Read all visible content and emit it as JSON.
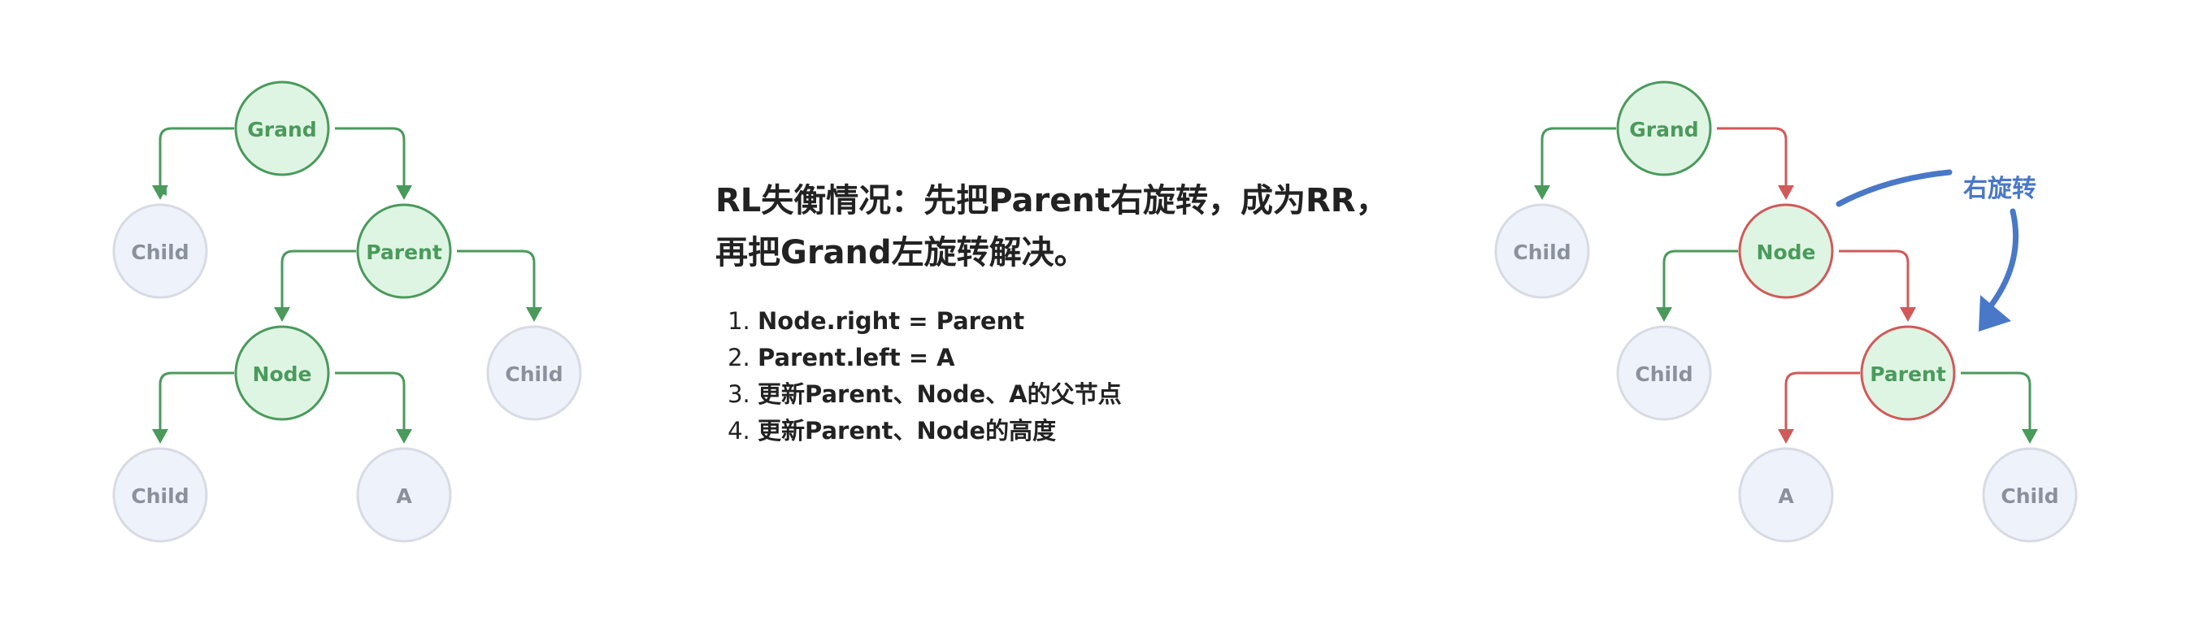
{
  "left_tree": {
    "grand": "Grand",
    "parent": "Parent",
    "node": "Node",
    "child_grand_left": "Child",
    "child_parent_right": "Child",
    "child_node_left": "Child",
    "a": "A"
  },
  "description": {
    "title_line1": "RL失衡情况：先把Parent右旋转，成为RR，",
    "title_line2": "再把Grand左旋转解决。",
    "steps": [
      "Node.right =  Parent",
      "Parent.left = A",
      "更新Parent、Node、A的父节点",
      "更新Parent、Node的高度"
    ]
  },
  "right_tree": {
    "grand": "Grand",
    "node": "Node",
    "parent": "Parent",
    "child_grand_left": "Child",
    "child_node_left": "Child",
    "a": "A",
    "child_parent_right": "Child",
    "rotation_label": "右旋转"
  },
  "colors": {
    "green": "#4a9a5c",
    "green_fill": "#dff5e3",
    "red": "#d05a5a",
    "gray_stroke": "#d8dbe3",
    "gray_fill": "#eef2fb",
    "gray_text": "#8a909c",
    "blue": "#4a78c8"
  }
}
